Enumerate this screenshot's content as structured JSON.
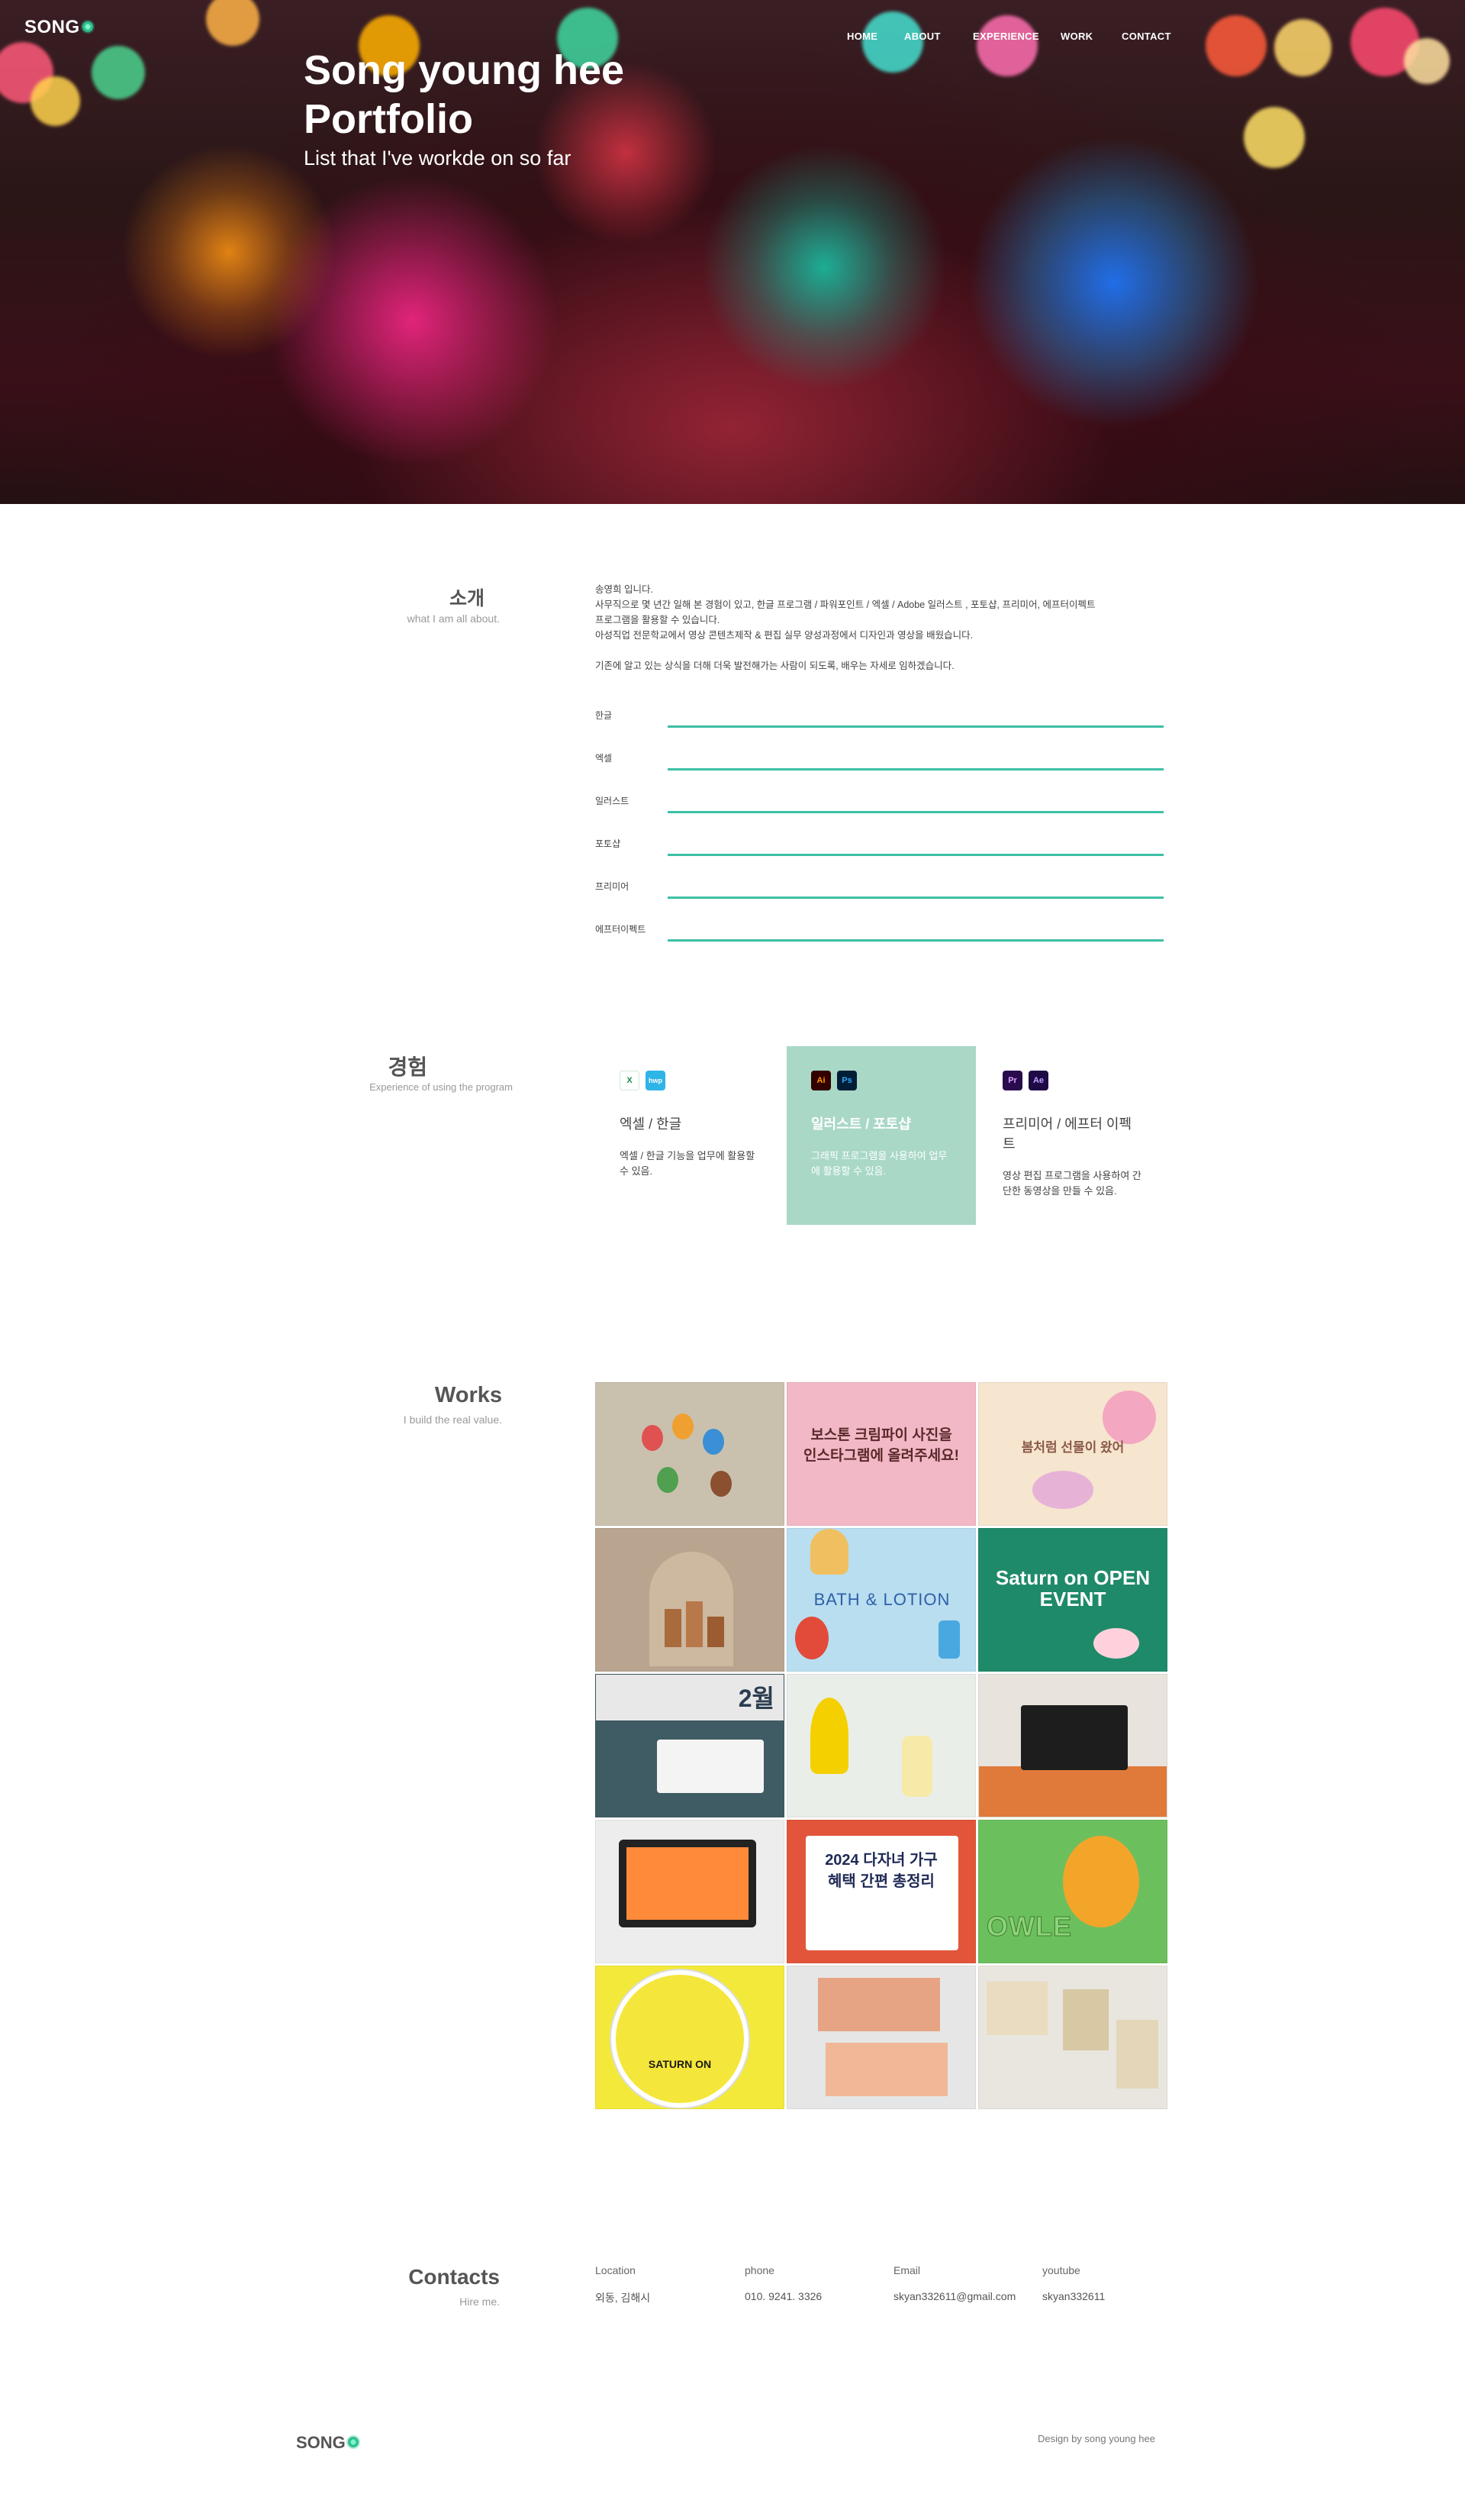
{
  "header": {
    "logo": "SONG",
    "nav": [
      "HOME",
      "ABOUT",
      "EXPERIENCE",
      "WORK",
      "CONTACT"
    ],
    "title_line1": "Song young hee",
    "title_line2": "Portfolio",
    "subtitle": "List that I've workde on so far"
  },
  "about": {
    "title": "소개",
    "subtitle": "what I am all about.",
    "lines": [
      "송영희 입니다.",
      "사무직으로 몇 년간 일해 본 경험이 있고, 한글 프로그램 / 파워포인트 / 엑셀 / Adobe 일러스트 , 포토샵, 프리미어, 에프터이펙트",
      "프로그램을 활용할 수 있습니다.",
      "아성직업 전문학교에서 영상 콘텐츠제작 & 편집 실무 양성과정에서 디자인과 영상을 배웠습니다.",
      "",
      "기존에 알고 있는 상식을 더해 더욱 발전해가는 사람이 되도록, 배우는 자세로 임하겠습니다."
    ],
    "skills": [
      {
        "label": "한글",
        "level": 1.0
      },
      {
        "label": "엑셀",
        "level": 1.0
      },
      {
        "label": "일러스트",
        "level": 1.0
      },
      {
        "label": "포토샵",
        "level": 1.0
      },
      {
        "label": "프리미어",
        "level": 1.0
      },
      {
        "label": "에프터이펙트",
        "level": 1.0
      }
    ]
  },
  "experience": {
    "title": "경험",
    "subtitle": "Experience of using the program",
    "cards": [
      {
        "icons": [
          "X",
          "hwp"
        ],
        "name": "엑셀 / 한글",
        "desc": "엑셀 / 한글 기능을 업무에 활용할 수 있음."
      },
      {
        "icons": [
          "Ai",
          "Ps"
        ],
        "name": "일러스트 / 포토샵",
        "desc": "그래픽 프로그램을 사용하여 업무에 활용할 수 있음."
      },
      {
        "icons": [
          "Pr",
          "Ae"
        ],
        "name": "프리미어 / 에프터 이펙트",
        "desc": "영상 편집 프로그램을 사용하여 간단한 동영상을 만들 수 있음."
      }
    ]
  },
  "works": {
    "title": "Works",
    "subtitle": "I build the real value.",
    "items": [
      {
        "caption": "",
        "bg": "#c9c1ae"
      },
      {
        "caption": "보스톤 크림파이 사진을 인스타그램에 올려주세요!",
        "bg": "#f2b8c6"
      },
      {
        "caption": "봄처럼 선물이 왔어",
        "bg": "#f6e5cf"
      },
      {
        "caption": "",
        "bg": "#b9a48f"
      },
      {
        "caption": "BATH & LOTION",
        "bg": "#b8def0"
      },
      {
        "caption": "Saturn on OPEN EVENT",
        "bg": "#1f8a6a"
      },
      {
        "caption": "2월",
        "bg": "#3f5b63"
      },
      {
        "caption": "",
        "bg": "#e9eee8"
      },
      {
        "caption": "",
        "bg": "#e8e3dc"
      },
      {
        "caption": "",
        "bg": "#ededed"
      },
      {
        "caption": "2024 다자녀 가구 혜택 간편 총정리",
        "bg": "#e2553a"
      },
      {
        "caption": "OWLE",
        "bg": "#6cbf5d"
      },
      {
        "caption": "SATURN ON",
        "bg": "#f3e93a"
      },
      {
        "caption": "",
        "bg": "#e6e6e6"
      },
      {
        "caption": "",
        "bg": "#e9e6df"
      }
    ]
  },
  "contacts": {
    "title": "Contacts",
    "subtitle": "Hire me.",
    "items": [
      {
        "label": "Location",
        "value": "외동, 김해시"
      },
      {
        "label": "phone",
        "value": "010. 9241. 3326"
      },
      {
        "label": "Email",
        "value": "skyan332611@gmail.com"
      },
      {
        "label": "youtube",
        "value": "skyan332611"
      }
    ]
  },
  "footer": {
    "logo": "SONG",
    "credit": "Design by song young hee"
  },
  "colors": {
    "accent": "#3cc0a4",
    "card_active": "#a9d8c7"
  }
}
